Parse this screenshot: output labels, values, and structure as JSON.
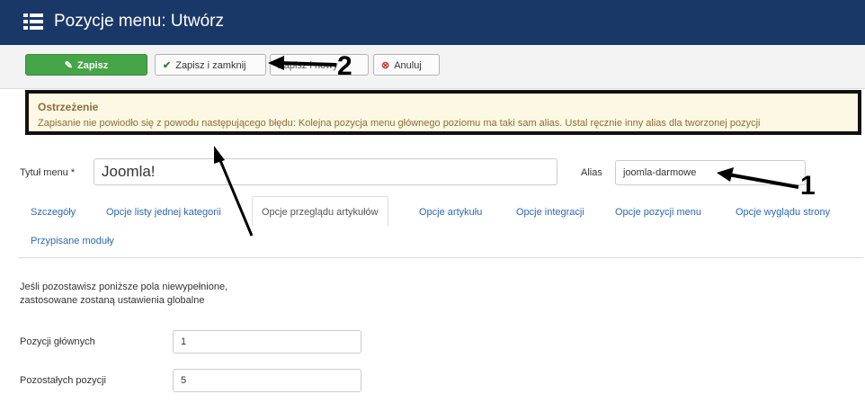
{
  "header": {
    "title": "Pozycje menu: Utwórz"
  },
  "toolbar": {
    "save": "Zapisz",
    "save_close": "Zapisz i zamknij",
    "save_new": "Zapisz i nowy",
    "cancel": "Anuluj"
  },
  "alert": {
    "title": "Ostrzeżenie",
    "message": "Zapisanie nie powiodło się z powodu następującego błędu: Kolejna pozycja menu głównego poziomu ma taki sam alias. Ustal ręcznie inny alias dla tworzonej pozycji"
  },
  "form": {
    "title_label": "Tytuł menu *",
    "title_value": "Joomla!",
    "alias_label": "Alias",
    "alias_value": "joomla-darmowe"
  },
  "tabs": [
    {
      "label": "Szczegóły"
    },
    {
      "label": "Opcje listy jednej kategorii"
    },
    {
      "label": "Opcje przeglądu artykułów",
      "active": true
    },
    {
      "label": "Opcje artykułu"
    },
    {
      "label": "Opcje integracji"
    },
    {
      "label": "Opcje pozycji menu"
    },
    {
      "label": "Opcje wyglądu strony"
    },
    {
      "label": "Przypisane moduły"
    }
  ],
  "content": {
    "info_line1": "Jeśli pozostawisz poniższe pola niewypełnione,",
    "info_line2": "zastosowane zostaną ustawienia globalne",
    "fields": [
      {
        "label": "Pozycji głównych",
        "value": "1"
      },
      {
        "label": "Pozostałych pozycji",
        "value": "5"
      }
    ]
  },
  "annotations": {
    "one": "1",
    "two": "2"
  },
  "colors": {
    "header_bg": "#1a3867",
    "save_green": "#46a546",
    "alert_bg": "#fcf8e3",
    "link_blue": "#2a69b8"
  }
}
